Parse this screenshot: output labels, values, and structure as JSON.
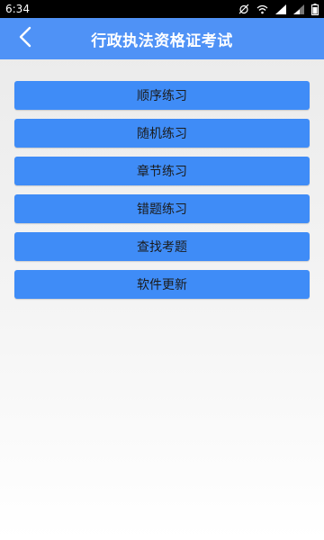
{
  "status_bar": {
    "time": "6:34",
    "icons": [
      "alarm-off-icon",
      "wifi-icon",
      "signal-icon",
      "signal-icon",
      "battery-icon"
    ]
  },
  "header": {
    "title": "行政执法资格证考试",
    "back_icon": "chevron-left-icon",
    "background": "#4f92f6"
  },
  "menu": {
    "items": [
      {
        "label": "顺序练习"
      },
      {
        "label": "随机练习"
      },
      {
        "label": "章节练习"
      },
      {
        "label": "错题练习"
      },
      {
        "label": "查找考题"
      },
      {
        "label": "软件更新"
      }
    ],
    "button_color": "#3f8cf7"
  }
}
